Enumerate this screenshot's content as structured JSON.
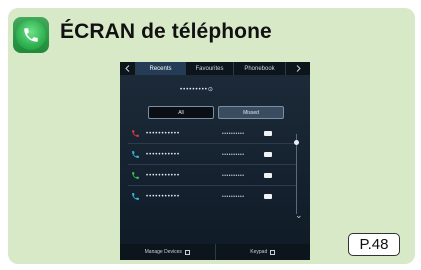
{
  "header": {
    "title": "ÉCRAN de téléphone",
    "icon": "phone-app-icon",
    "icon_color": "#2fb351"
  },
  "screen": {
    "tabs": [
      {
        "label": "",
        "icon": "back-icon"
      },
      {
        "label": "Recents",
        "active": true
      },
      {
        "label": "Favourites",
        "active": false
      },
      {
        "label": "Phonebook",
        "active": false
      },
      {
        "label": "",
        "icon": "chevron-right-icon"
      }
    ],
    "search_text": "•••••••••⊙",
    "toggle": {
      "left_label": "All",
      "right_label": "Missed"
    },
    "calls": [
      {
        "icon": "missed-call-icon",
        "color": "#e2383f",
        "name": "•••••••••••",
        "date": "••••••••••"
      },
      {
        "icon": "incoming-call-icon",
        "color": "#36c0e0",
        "name": "•••••••••••",
        "date": "••••••••••"
      },
      {
        "icon": "outgoing-call-icon",
        "color": "#3ec45a",
        "name": "•••••••••••",
        "date": "••••••••••"
      },
      {
        "icon": "incoming-call-icon",
        "color": "#36c0e0",
        "name": "•••••••••••",
        "date": "••••••••••"
      }
    ],
    "bottom": {
      "left_label": "Manage Devices",
      "right_label": "Keypad"
    }
  },
  "page_ref": "P.48"
}
